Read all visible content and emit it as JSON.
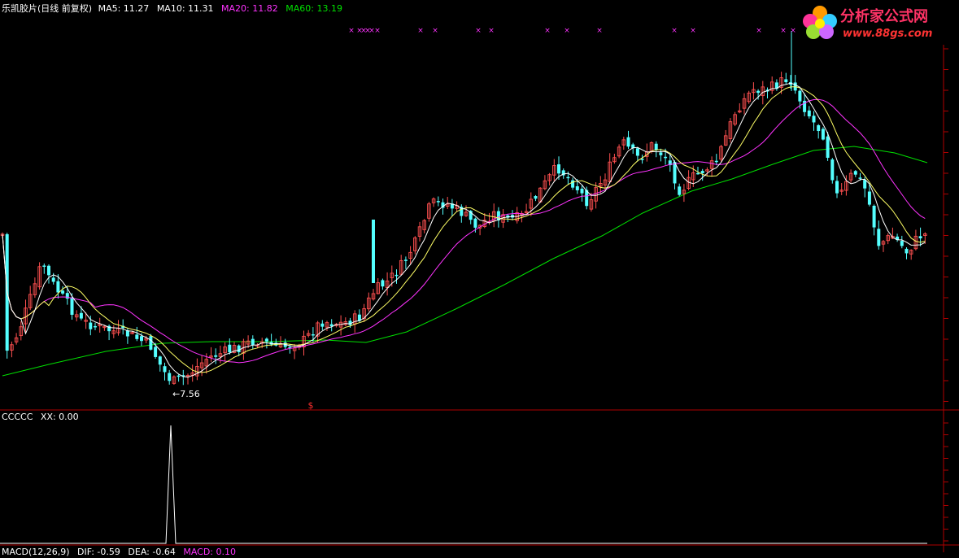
{
  "header": {
    "title": "乐凯胶片(日线 前复权)",
    "ma5_label": "MA5: 11.27",
    "ma10_label": "MA10: 11.31",
    "ma20_label": "MA20: 11.82",
    "ma60_label": "MA60: 13.19"
  },
  "sub_header": {
    "indicator_label": "CCCCC",
    "xx_label": "XX: 0.00"
  },
  "bottom_header": {
    "macd_label": "MACD(12,26,9)",
    "dif_label": "DIF: -0.59",
    "dea_label": "DEA: -0.64",
    "macd_value_label": "MACD: 0.10"
  },
  "logo": {
    "text_cn": "分析家公式网",
    "text_url": "www.88gs.com"
  },
  "colors": {
    "background": "#000000",
    "border": "#b00000",
    "candle_up": "#ff5050",
    "candle_down": "#54ffff",
    "ma5": "#ffffff",
    "ma10": "#ffff66",
    "ma20": "#ff33ff",
    "ma60": "#00e000",
    "signal": "#ff33ff"
  },
  "chart_data": [
    {
      "type": "candlestick",
      "title": "乐凯胶片(日线 前复权)",
      "annotations": [
        {
          "label": "7.56",
          "value": 7.56
        },
        {
          "label": "$"
        }
      ],
      "series": [
        {
          "name": "MA5",
          "value": 11.27
        },
        {
          "name": "MA10",
          "value": 11.31
        },
        {
          "name": "MA20",
          "value": 11.82
        },
        {
          "name": "MA60",
          "value": 13.19
        }
      ],
      "signal_marker": "×"
    },
    {
      "type": "line",
      "title": "CCCCC",
      "series": [
        {
          "name": "XX",
          "value": 0.0
        }
      ]
    }
  ]
}
